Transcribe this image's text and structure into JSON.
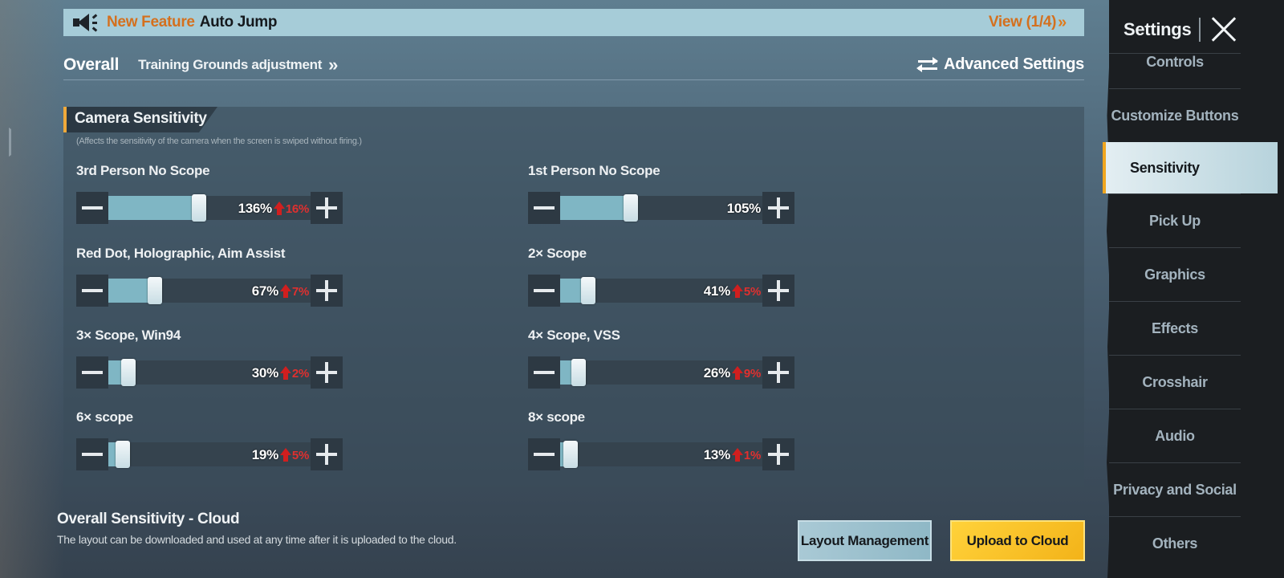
{
  "banner": {
    "new_label": "New Feature",
    "title": "Auto Jump",
    "view_label": "View (1/4)",
    "icon": "speaker-icon"
  },
  "tabs": {
    "overall": "Overall",
    "training": "Training Grounds adjustment",
    "advanced": "Advanced Settings"
  },
  "panel": {
    "title": "Camera Sensitivity",
    "description": "(Affects the sensitivity of the camera when the screen is swiped without firing.)",
    "sliders": [
      {
        "label": "3rd Person No Scope",
        "value": "136%",
        "delta": "16%",
        "fraction": 0.45
      },
      {
        "label": "1st Person No Scope",
        "value": "105%",
        "delta": "",
        "fraction": 0.35
      },
      {
        "label": "Red Dot, Holographic, Aim Assist",
        "value": "67%",
        "delta": "7%",
        "fraction": 0.23
      },
      {
        "label": "2× Scope",
        "value": "41%",
        "delta": "5%",
        "fraction": 0.14
      },
      {
        "label": "3× Scope, Win94",
        "value": "30%",
        "delta": "2%",
        "fraction": 0.1
      },
      {
        "label": "4× Scope, VSS",
        "value": "26%",
        "delta": "9%",
        "fraction": 0.09
      },
      {
        "label": "6× scope",
        "value": "19%",
        "delta": "5%",
        "fraction": 0.07
      },
      {
        "label": "8× scope",
        "value": "13%",
        "delta": "1%",
        "fraction": 0.05
      }
    ]
  },
  "cloud": {
    "title": "Overall Sensitivity - Cloud",
    "description": "The layout can be downloaded and used at any time after it is uploaded to the cloud.",
    "layout_button": "Layout Management",
    "upload_button": "Upload to Cloud"
  },
  "sidebar": {
    "title": "Settings",
    "items": [
      "Controls",
      "Customize Buttons",
      "Sensitivity",
      "Pick Up",
      "Graphics",
      "Effects",
      "Crosshair",
      "Audio",
      "Privacy and Social",
      "Others"
    ],
    "active_index": 2
  },
  "colors": {
    "accent_orange": "#d4701e",
    "active_stripe": "#f0a61f",
    "increase_red": "#d01f1f",
    "upload_yellow": "#f3b319",
    "slider_fill": "#7fb6c4"
  }
}
